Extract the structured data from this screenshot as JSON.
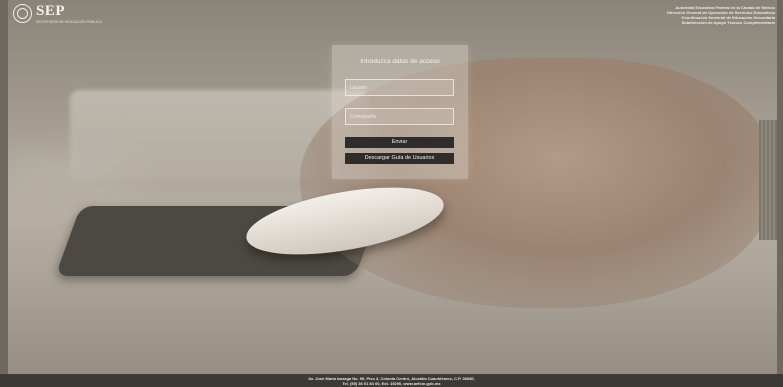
{
  "branding": {
    "logo_text": "SEP",
    "logo_subtitle": "SECRETARÍA DE EDUCACIÓN PÚBLICA",
    "seal_icon": "seal-icon"
  },
  "institution_lines": [
    "Autoridad Educativa Federal en la Ciudad de México",
    "Dirección General de Operación de Servicios Educativos",
    "Coordinación Sectorial de Educación Secundaria",
    "Subdirección de Apoyo Técnico Complementario"
  ],
  "login": {
    "title": "Introduzca datos de acceso",
    "username_placeholder": "Usuario",
    "password_placeholder": "Contraseña",
    "submit_label": "Enviar",
    "guide_label": "Descargar Guía de Usuarios"
  },
  "footer": {
    "line1": "Av. José María Izazaga No. 99, Piso 3, Colonia Centro, Alcaldía Cuauhtémoc, C.P. 06080,",
    "line2": "Tel. (55) 36 01 84 00, Ext. 19290, www.aefcm.gob.mx"
  }
}
